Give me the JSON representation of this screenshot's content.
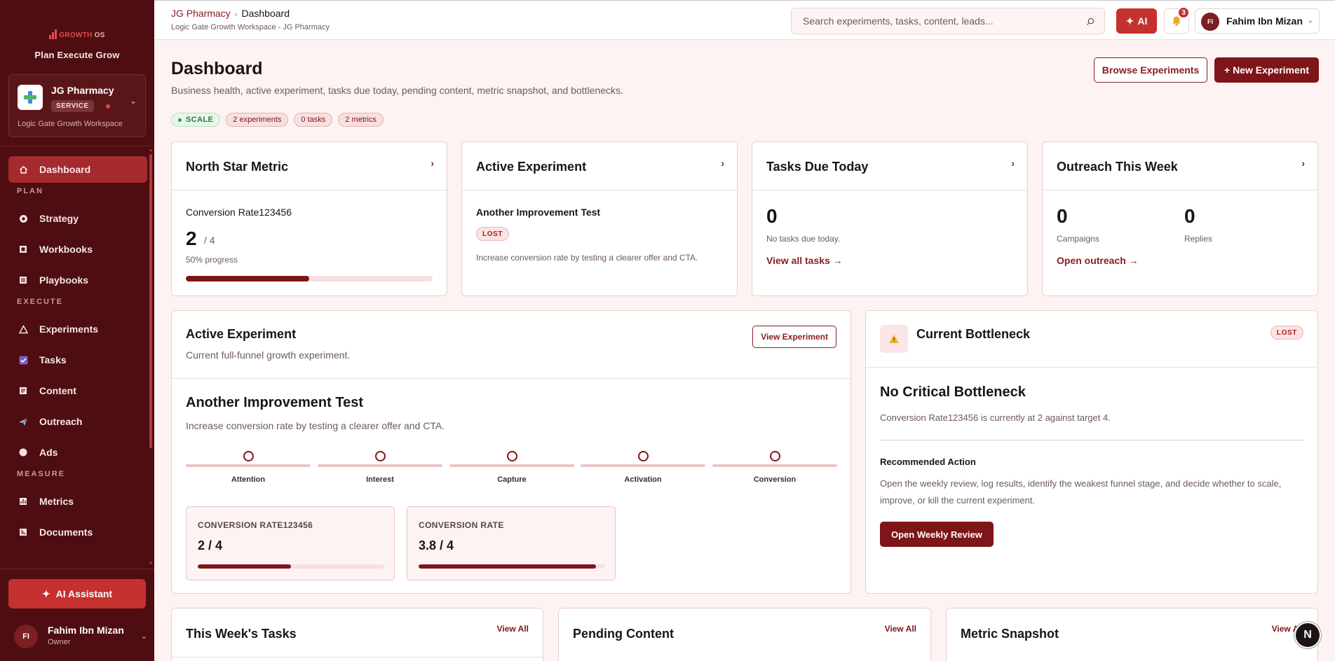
{
  "brand": {
    "logo_text": "GROWTH",
    "logo_os": "OS",
    "tagline": "Plan Execute Grow"
  },
  "workspace": {
    "name": "JG Pharmacy",
    "badge": "SERVICE",
    "subtitle": "Logic Gate Growth Workspace"
  },
  "sidebar": {
    "dashboard": "Dashboard",
    "sections": {
      "plan": "PLAN",
      "execute": "EXECUTE",
      "measure": "MEASURE"
    },
    "plan_items": [
      "Strategy",
      "Workbooks",
      "Playbooks"
    ],
    "execute_items": [
      "Experiments",
      "Tasks",
      "Content",
      "Outreach",
      "Ads"
    ],
    "measure_items": [
      "Metrics",
      "Documents"
    ],
    "ai_assistant": "AI Assistant",
    "user": {
      "initials": "FI",
      "name": "Fahim Ibn Mizan",
      "role": "Owner"
    }
  },
  "topbar": {
    "crumb_workspace": "JG Pharmacy",
    "crumb_page": "Dashboard",
    "crumb_sub": "Logic Gate Growth Workspace - JG Pharmacy",
    "search_placeholder": "Search experiments, tasks, content, leads...",
    "ai_label": "AI",
    "notification_count": "3",
    "user": {
      "initials": "FI",
      "name": "Fahim Ibn Mizan"
    }
  },
  "header": {
    "title": "Dashboard",
    "subtitle": "Business health, active experiment, tasks due today, pending content, metric snapshot, and bottlenecks.",
    "browse_button": "Browse Experiments",
    "new_button": "+ New Experiment",
    "chips": {
      "stage": "SCALE",
      "experiments": "2 experiments",
      "tasks": "0 tasks",
      "metrics": "2 metrics"
    }
  },
  "north_star": {
    "title": "North Star Metric",
    "metric": "Conversion Rate123456",
    "value": "2",
    "target": "/ 4",
    "progress_text": "50% progress",
    "progress": 0.5
  },
  "active_experiment_card": {
    "title": "Active Experiment",
    "name": "Another Improvement Test",
    "status": "LOST",
    "description": "Increase conversion rate by testing a clearer offer and CTA."
  },
  "tasks_today": {
    "title": "Tasks Due Today",
    "count": "0",
    "empty_text": "No tasks due today.",
    "link": "View all tasks →"
  },
  "outreach": {
    "title": "Outreach This Week",
    "campaigns": "0",
    "campaigns_label": "Campaigns",
    "replies": "0",
    "replies_label": "Replies",
    "link": "Open outreach →"
  },
  "active_experiment": {
    "title": "Active Experiment",
    "subtitle": "Current full-funnel growth experiment.",
    "view_button": "View Experiment",
    "name": "Another Improvement Test",
    "description": "Increase conversion rate by testing a clearer offer and CTA.",
    "stages": [
      "Attention",
      "Interest",
      "Capture",
      "Activation",
      "Conversion"
    ],
    "metrics": [
      {
        "label": "CONVERSION RATE123456",
        "value": "2 / 4",
        "progress": 0.5
      },
      {
        "label": "CONVERSION RATE",
        "value": "3.8 / 4",
        "progress": 0.95
      }
    ]
  },
  "bottleneck": {
    "title": "Current Bottleneck",
    "status": "LOST",
    "heading": "No Critical Bottleneck",
    "text": "Conversion Rate123456 is currently at 2 against target 4.",
    "recommended_heading": "Recommended Action",
    "recommended_text": "Open the weekly review, log results, identify the weakest funnel stage, and decide whether to scale, improve, or kill the current experiment.",
    "button": "Open Weekly Review"
  },
  "bottom_cards": {
    "tasks": {
      "title": "This Week's Tasks",
      "view": "View All"
    },
    "content": {
      "title": "Pending Content",
      "view": "View All"
    },
    "metrics": {
      "title": "Metric Snapshot",
      "view": "View All"
    }
  },
  "floating_badge": "N",
  "colors": {
    "sidebar": "#4e0d10",
    "accent": "#7e1518",
    "ai": "#c4312f",
    "active_nav": "#a52a2e"
  }
}
